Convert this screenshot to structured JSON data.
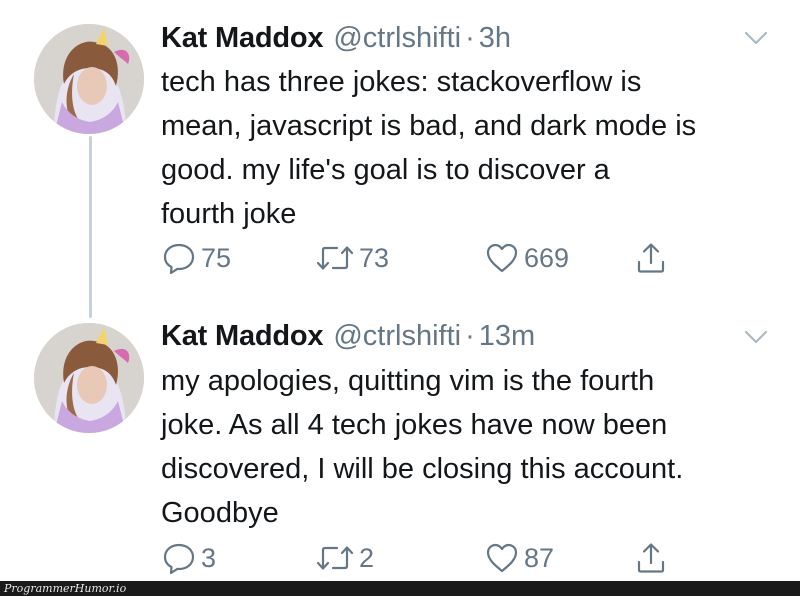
{
  "tweets": [
    {
      "display_name": "Kat Maddox",
      "handle": "@ctrlshifti",
      "separator": "·",
      "time": "3h",
      "lines": [
        "tech has three jokes: stackoverflow is",
        "mean, javascript is bad, and dark mode is",
        "good. my life's goal is to discover a",
        "fourth joke"
      ],
      "replies": "75",
      "retweets": "73",
      "likes": "669"
    },
    {
      "display_name": "Kat Maddox",
      "handle": "@ctrlshifti",
      "separator": "·",
      "time": "13m",
      "lines": [
        "my apologies, quitting vim is the fourth",
        "joke. As all 4 tech jokes have now been",
        "discovered, I will be closing this account.",
        "Goodbye"
      ],
      "replies": "3",
      "retweets": "2",
      "likes": "87"
    }
  ],
  "watermark": "ProgrammerHumor.io",
  "colors": {
    "text": "#14171a",
    "secondary": "#657786",
    "thread_line": "#c8d1d9",
    "footer": "#1a1a1a"
  },
  "icons": [
    "reply-icon",
    "retweet-icon",
    "like-icon",
    "share-icon",
    "chevron-down-icon"
  ]
}
